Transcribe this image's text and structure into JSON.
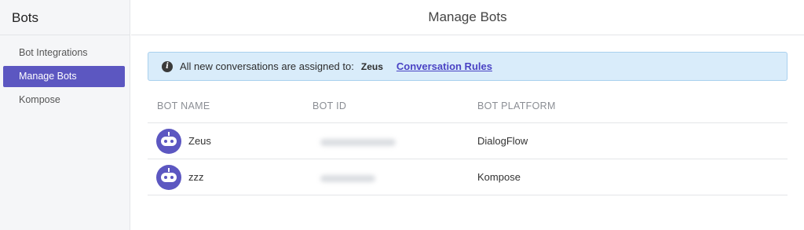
{
  "sidebar": {
    "title": "Bots",
    "items": [
      {
        "label": "Bot Integrations",
        "active": false
      },
      {
        "label": "Manage Bots",
        "active": true
      },
      {
        "label": "Kompose",
        "active": false
      }
    ]
  },
  "header": {
    "title": "Manage Bots"
  },
  "banner": {
    "icon": "info-icon",
    "text": "All new conversations are assigned to:",
    "assignee": "Zeus",
    "link_label": "Conversation Rules"
  },
  "table": {
    "columns": [
      "BOT NAME",
      "BOT ID",
      "BOT PLATFORM"
    ],
    "rows": [
      {
        "avatar": "robot-avatar-icon",
        "name": "Zeus",
        "bot_id": "(redacted)",
        "platform": "DialogFlow"
      },
      {
        "avatar": "robot-avatar-icon",
        "name": "zzz",
        "bot_id": "(redacted)",
        "platform": "Kompose"
      }
    ]
  },
  "colors": {
    "accent": "#5c57c1",
    "banner_bg": "#d9ecfa",
    "banner_border": "#a9d0ee",
    "link": "#4a43c4",
    "sidebar_bg": "#f5f6f8"
  }
}
